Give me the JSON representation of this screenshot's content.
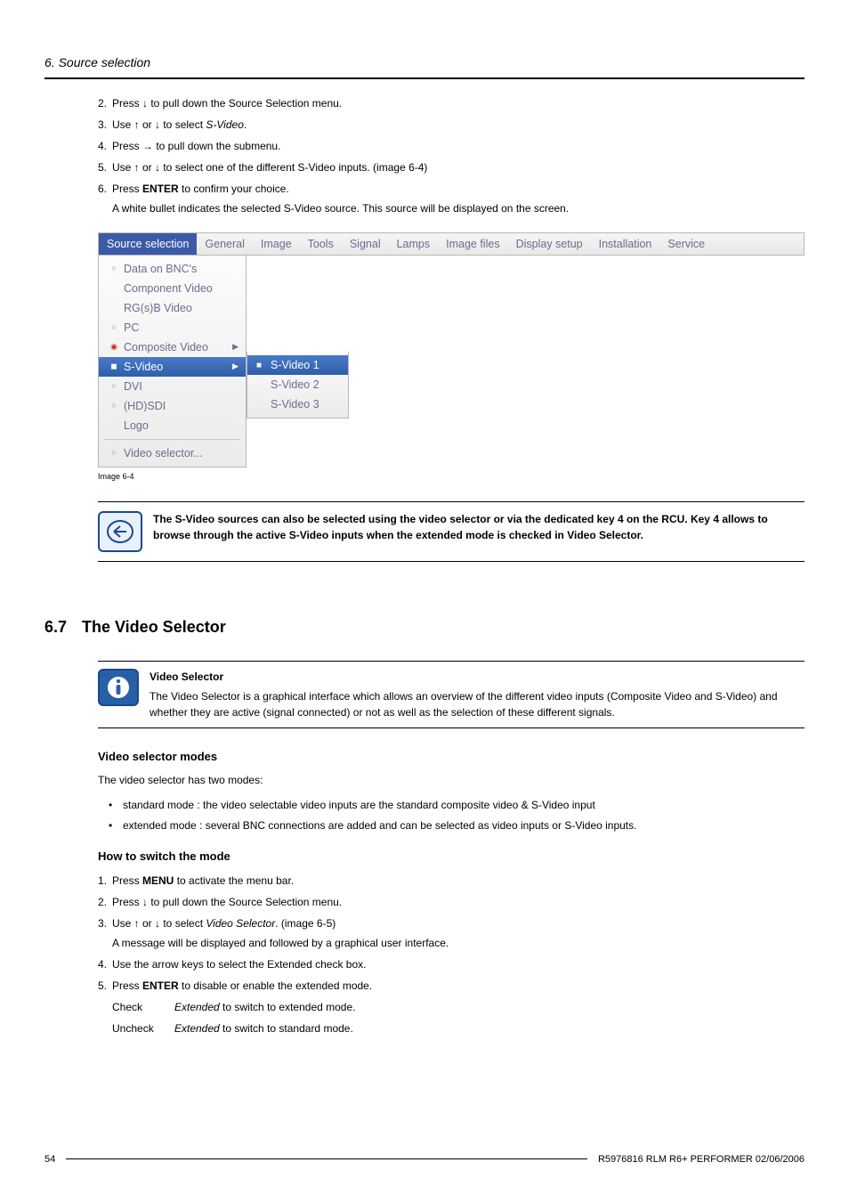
{
  "header": {
    "section_title": "6. Source selection"
  },
  "steps1": {
    "s2": {
      "num": "2.",
      "text_a": "Press ↓ to pull down the Source Selection menu."
    },
    "s3": {
      "num": "3.",
      "text_a": "Use ↑ or ↓ to select",
      "ital": "S-Video",
      "text_b": "."
    },
    "s4": {
      "num": "4.",
      "text_a": "Press → to pull down the submenu."
    },
    "s5": {
      "num": "5.",
      "text_a": "Use ↑ or ↓ to select one of the different S-Video inputs. (image 6-4)"
    },
    "s6": {
      "num": "6.",
      "text_a": "Press ",
      "bold": "ENTER",
      "text_b": " to confirm your choice."
    },
    "s6_sub": "A white bullet indicates the selected S-Video source. This source will be displayed on the screen."
  },
  "menu": {
    "tabs": {
      "t0": "Source selection",
      "t1": "General",
      "t2": "Image",
      "t3": "Tools",
      "t4": "Signal",
      "t5": "Lamps",
      "t6": "Image files",
      "t7": "Display setup",
      "t8": "Installation",
      "t9": "Service"
    },
    "items": {
      "i0": "Data on BNC's",
      "i1": "Component Video",
      "i2": "RG(s)B Video",
      "i3": "PC",
      "i4": "Composite Video",
      "i5": "S-Video",
      "i6": "DVI",
      "i7": "(HD)SDI",
      "i8": "Logo",
      "i9": "Video selector..."
    },
    "sub": {
      "s0": "S-Video 1",
      "s1": "S-Video 2",
      "s2": "S-Video 3"
    }
  },
  "image_caption": "Image 6-4",
  "tip_note": "The S-Video sources can also be selected using the video selector or via the dedicated key 4 on the RCU. Key 4 allows to browse through the active S-Video inputs when the extended mode is checked in Video Selector.",
  "section67": {
    "num": "6.7",
    "title": "The Video Selector"
  },
  "info_box": {
    "title": "Video Selector",
    "body": "The Video Selector is a graphical interface which allows an overview of the different video inputs (Composite Video and S-Video) and whether they are active (signal connected) or not as well as the selection of these different signals."
  },
  "modes": {
    "heading": "Video selector modes",
    "intro": "The video selector has two modes:",
    "m1": "standard mode : the video selectable video inputs are the standard composite video & S-Video input",
    "m2": "extended mode : several BNC connections are added and can be selected as video inputs or S-Video inputs."
  },
  "howto": {
    "heading": "How to switch the mode",
    "s1": {
      "num": "1.",
      "a": "Press ",
      "bold": "MENU",
      "b": " to activate the menu bar."
    },
    "s2": {
      "num": "2.",
      "a": "Press ↓ to pull down the Source Selection menu."
    },
    "s3": {
      "num": "3.",
      "a": "Use ↑ or ↓ to select ",
      "ital": "Video Selector",
      "b": ". (image 6-5)",
      "sub": "A message will be displayed and followed by a graphical user interface."
    },
    "s4": {
      "num": "4.",
      "a": "Use the arrow keys to select the Extended check box."
    },
    "s5": {
      "num": "5.",
      "a": "Press ",
      "bold": "ENTER",
      "b": " to disable or enable the extended mode."
    },
    "check1": {
      "lbl": "Check",
      "ital": "Extended",
      "rest": " to switch to extended mode."
    },
    "check2": {
      "lbl": "Uncheck",
      "ital": "Extended",
      "rest": " to switch to standard mode."
    }
  },
  "footer": {
    "page": "54",
    "doc": "R5976816 RLM R6+ PERFORMER 02/06/2006"
  }
}
